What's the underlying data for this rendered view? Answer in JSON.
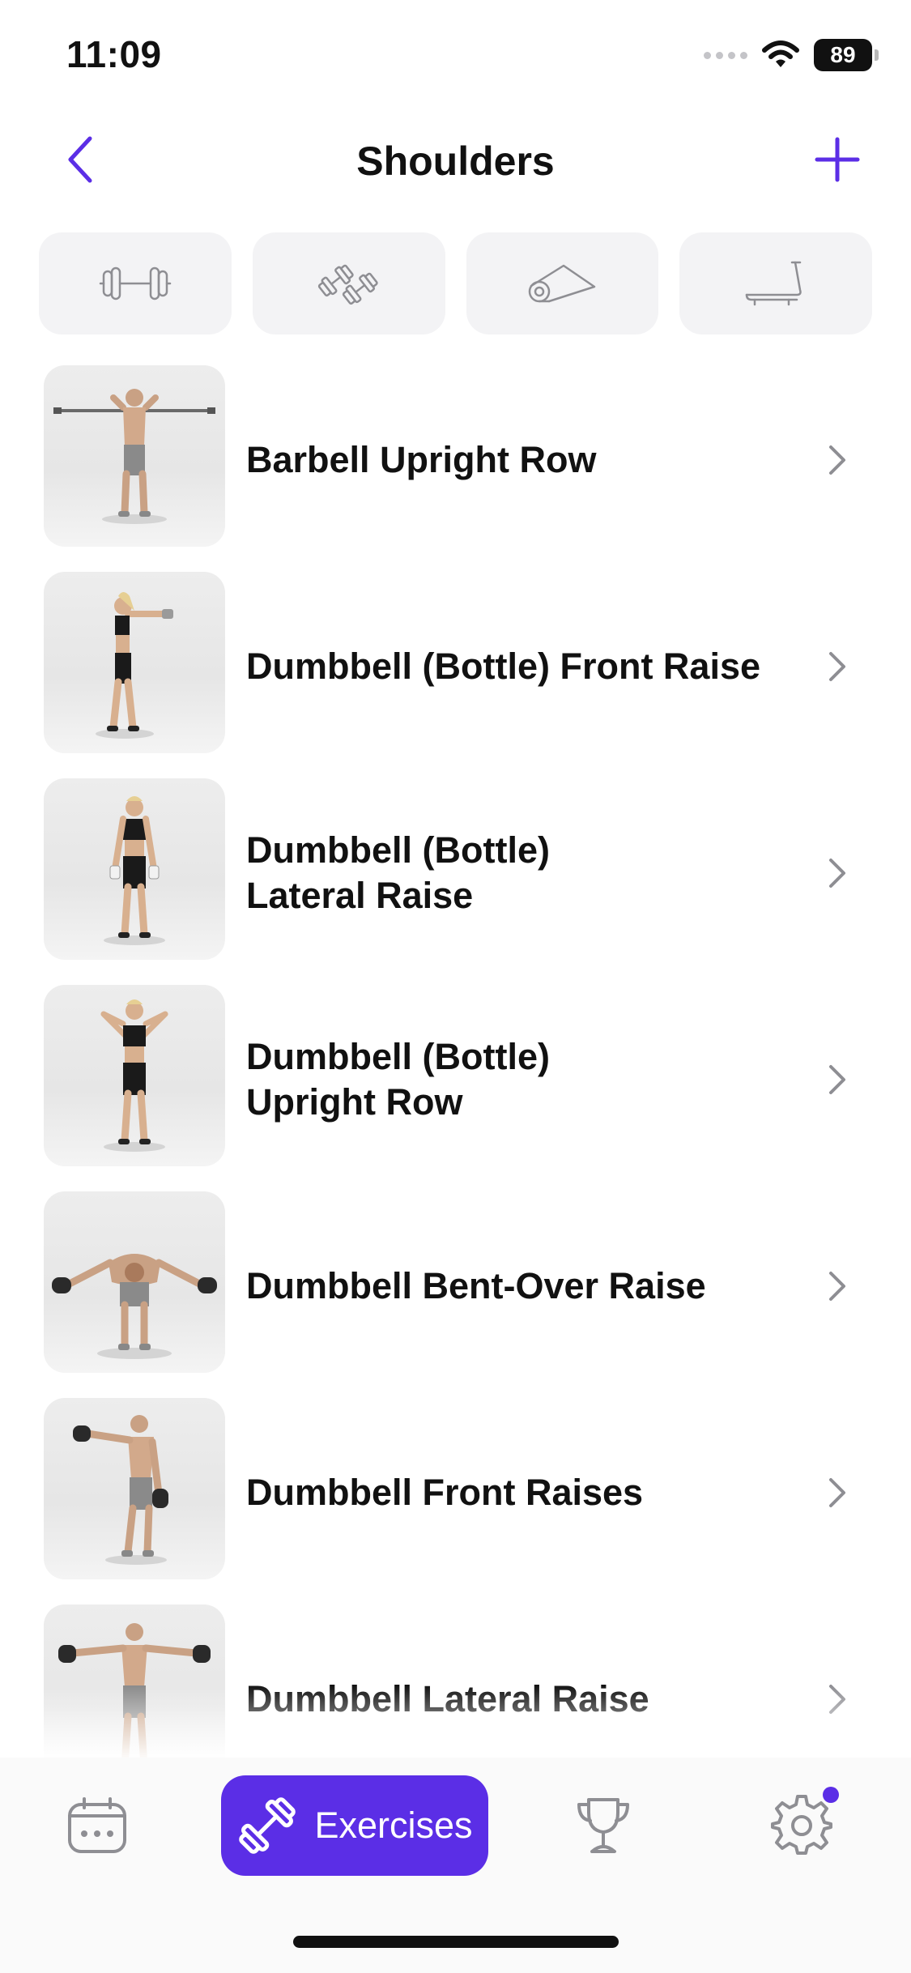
{
  "status_bar": {
    "time": "11:09",
    "battery": "89",
    "icons": [
      "cellular-icon",
      "wifi-icon",
      "battery-icon"
    ]
  },
  "nav": {
    "title": "Shoulders",
    "back_icon": "chevron-left-icon",
    "add_icon": "plus-icon"
  },
  "filters": [
    {
      "icon": "barbell-icon"
    },
    {
      "icon": "dumbbell-icon"
    },
    {
      "icon": "mat-icon"
    },
    {
      "icon": "treadmill-icon"
    }
  ],
  "exercises": [
    {
      "name": "Barbell Upright Row"
    },
    {
      "name": "Dumbbell (Bottle) Front Raise"
    },
    {
      "name": "Dumbbell (Bottle)\nLateral Raise"
    },
    {
      "name": "Dumbbell (Bottle)\nUpright Row"
    },
    {
      "name": "Dumbbell Bent-Over Raise"
    },
    {
      "name": "Dumbbell Front Raises"
    },
    {
      "name": "Dumbbell Lateral Raise"
    }
  ],
  "tab_bar": {
    "tabs": [
      {
        "icon": "calendar-icon",
        "label": ""
      },
      {
        "icon": "dumbbell-icon",
        "label": "Exercises",
        "active": true
      },
      {
        "icon": "trophy-icon",
        "label": ""
      },
      {
        "icon": "gear-icon",
        "label": "",
        "badge": true
      }
    ]
  },
  "colors": {
    "accent": "#5b2ee6",
    "chip_background": "#f3f3f5",
    "icon_gray": "#8e8e93"
  }
}
